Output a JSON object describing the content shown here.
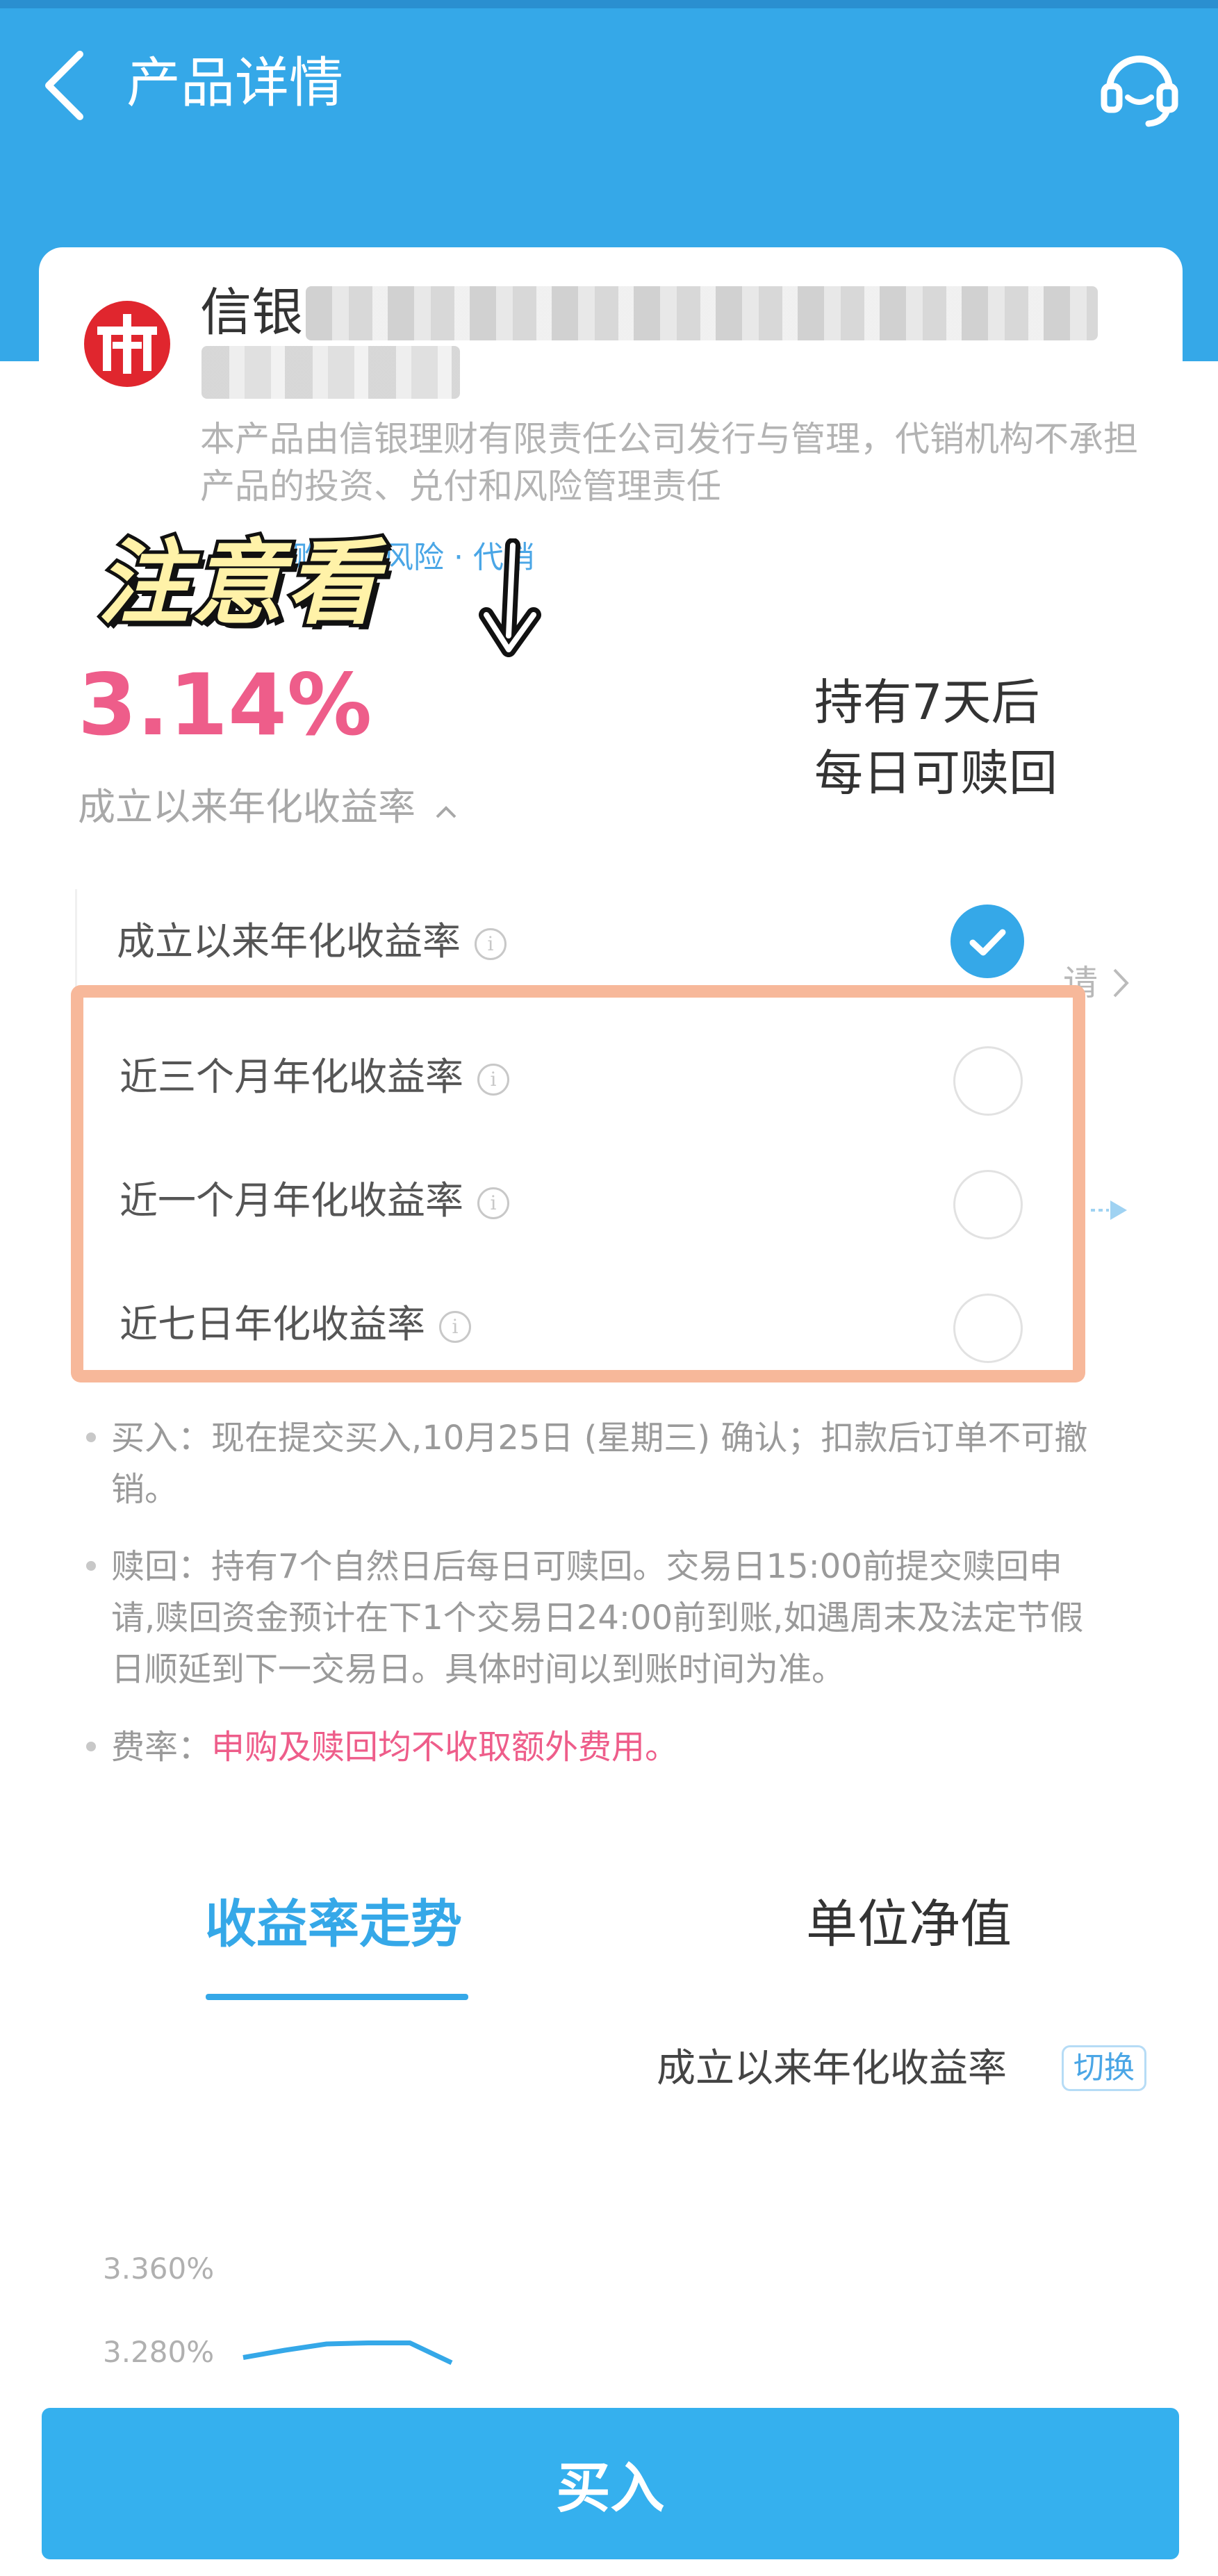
{
  "header": {
    "title": "产品详情"
  },
  "product": {
    "name_prefix": "信银",
    "description": "本产品由信银理财有限责任公司发行与管理，代销机构不承担产品的投资、兑付和风险管理责任",
    "tags": "1元起购 · 低风险 · 代销"
  },
  "overlay": {
    "sticker": "注意看",
    "arrow": "↓"
  },
  "rate": {
    "value": "3.14%",
    "label": "成立以来年化收益率"
  },
  "redeem_note": {
    "line1": "持有7天后",
    "line2": "每日可赎回"
  },
  "rate_options": {
    "selected": "成立以来年化收益率",
    "three_month": "近三个月年化收益率",
    "one_month": "近一个月年化收益率",
    "seven_day": "近七日年化收益率",
    "info_glyph": "i",
    "side_text": "请"
  },
  "rules": {
    "buy": "买入：现在提交买入,10月25日 (星期三) 确认；扣款后订单不可撤销。",
    "redeem": "赎回：持有7个自然日后每日可赎回。交易日15:00前提交赎回申请,赎回资金预计在下1个交易日24:00前到账,如遇周末及法定节假日顺延到下一交易日。具体时间以到账时间为准。",
    "fee_label": "费率：",
    "fee_value": "申购及赎回均不收取额外费用。"
  },
  "tabs": {
    "trend": "收益率走势",
    "nav": "单位净值"
  },
  "chart_header": {
    "metric": "成立以来年化收益率",
    "switch_label": "切换"
  },
  "chart_data": {
    "type": "line",
    "y_tick_labels": [
      "3.360%",
      "3.280%"
    ],
    "ylim": [
      3.28,
      3.36
    ],
    "series": [
      {
        "values": [
          3.275,
          3.282,
          3.288,
          3.289,
          3.289,
          3.27
        ]
      }
    ]
  },
  "footer": {
    "buy_label": "买入"
  },
  "colors": {
    "brand_blue": "#35a8e8",
    "accent_pink": "#ee5d8a",
    "highlight_orange": "#f7b89a"
  }
}
